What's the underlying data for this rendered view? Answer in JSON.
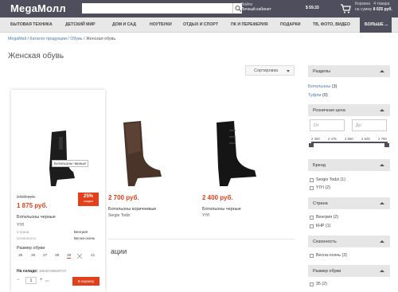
{
  "header": {
    "logo": "MegaМолл",
    "login_top": "Войти",
    "login_bottom": "Личный кабинет",
    "balance": "$ 59.33",
    "cart_title": "Корзина",
    "cart_count": "4 товара",
    "cart_sum_label": "на сумму",
    "cart_sum": "8 025 руб."
  },
  "nav": [
    "БЫТОВАЯ ТЕХНИКА",
    "ДЕТСКИЙ МИР",
    "ДОМ И САД",
    "НОУТБУКИ",
    "ОТДЫХ И СПОРТ",
    "ПК И ПЕРЕФЕРИЯ",
    "ПОДАРКИ",
    "ТВ, ФОТО, ВИДЕО",
    "БОЛЬШЕ ..."
  ],
  "breadcrumb": {
    "home": "MegaMall",
    "sep": "/",
    "catalog": "Каталог продукции",
    "shoes": "Обувь",
    "current": "Женская обувь"
  },
  "page_title": "Женская обувь",
  "sort_label": "Сортировка",
  "products": [
    {
      "name": "Ботильоны черные",
      "brand": "YIYI",
      "old_price": "2 500 руб.",
      "price": "1 875 руб.",
      "discount": "25%",
      "discount_note": "скидка",
      "tooltip": "Ботильоны черные"
    },
    {
      "name": "Ботильоны коричневые",
      "brand": "Sergio Todzi",
      "price": "2 700 руб."
    },
    {
      "name": "Ботильоны черные",
      "brand": "YIYI",
      "price": "2 400 руб."
    }
  ],
  "card": {
    "country_label": "Страна",
    "country": "Венгрия",
    "season_label": "Сезонность",
    "season": "Весна-осень",
    "size_label": "Размер обуви",
    "sizes": [
      "35",
      "36",
      "37",
      "38",
      "39",
      "40",
      "41"
    ],
    "stock_label": "На складе:",
    "stock_value": "заканчивается",
    "qty": "1",
    "unit": "шт",
    "buy": "В корзину"
  },
  "section_tail": "ации",
  "sidebar": {
    "sections_title": "Разделы",
    "links": [
      {
        "label": "Ботильоны",
        "count": "(3)"
      },
      {
        "label": "Туфли",
        "count": "(0)"
      }
    ],
    "price_title": "Розничная цена",
    "from_ph": "От",
    "to_ph": "До",
    "ticks": [
      "2 400",
      "2 475",
      "2 550",
      "2 625",
      "2 700"
    ],
    "brand_title": "Бренд",
    "brands": [
      "Sergio Todzi (1)",
      "YIYI (2)"
    ],
    "country_title": "Страна",
    "countries": [
      "Венгрия (2)",
      "КНР (1)"
    ],
    "season_title": "Сезонность",
    "seasons": [
      "Весна-осень (3)"
    ],
    "size_title": "Размер обуви",
    "sizes": [
      "35 (2)"
    ]
  }
}
